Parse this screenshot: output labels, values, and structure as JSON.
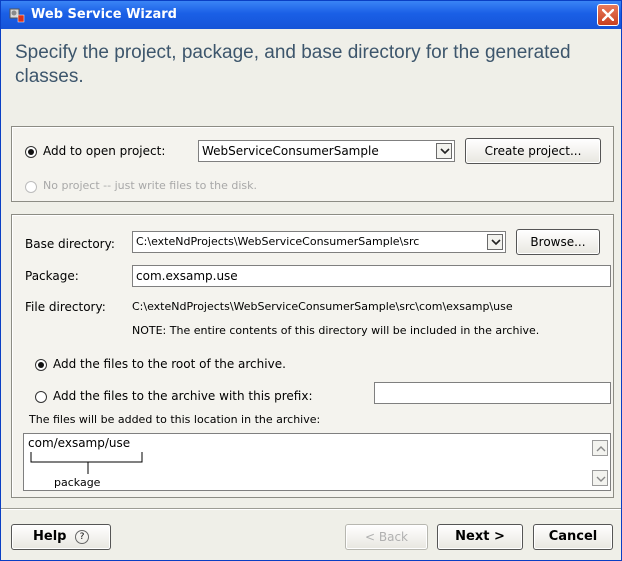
{
  "window": {
    "title": "Web Service Wizard",
    "titlebar_color": "#1a5fe6"
  },
  "heading": "Specify the project, package, and base directory for the generated classes.",
  "project": {
    "add_to_open_label": "Add to open project:",
    "add_to_open_checked": true,
    "project_value": "WebServiceConsumerSample",
    "create_project_label": "Create project...",
    "no_project_label": "No project -- just write files to the disk.",
    "no_project_enabled": false
  },
  "directory": {
    "base_label": "Base directory:",
    "base_value": "C:\\exteNdProjects\\WebServiceConsumerSample\\src",
    "browse_label": "Browse...",
    "package_label": "Package:",
    "package_value": "com.exsamp.use",
    "file_dir_label": "File directory:",
    "file_dir_value": "C:\\exteNdProjects\\WebServiceConsumerSample\\src\\com\\exsamp\\use",
    "note": "NOTE: The entire contents of this directory will be included in the archive."
  },
  "archive": {
    "root_label": "Add the files to the root of the archive.",
    "root_checked": true,
    "prefix_label": "Add the files to the archive with this prefix:",
    "prefix_value": "",
    "location_label": "The files will be added to this location in the archive:",
    "location_path": "com/exsamp/use",
    "location_caption": "package"
  },
  "footer": {
    "help_label": "Help",
    "back_label": "< Back",
    "next_label": "Next >",
    "cancel_label": "Cancel"
  }
}
